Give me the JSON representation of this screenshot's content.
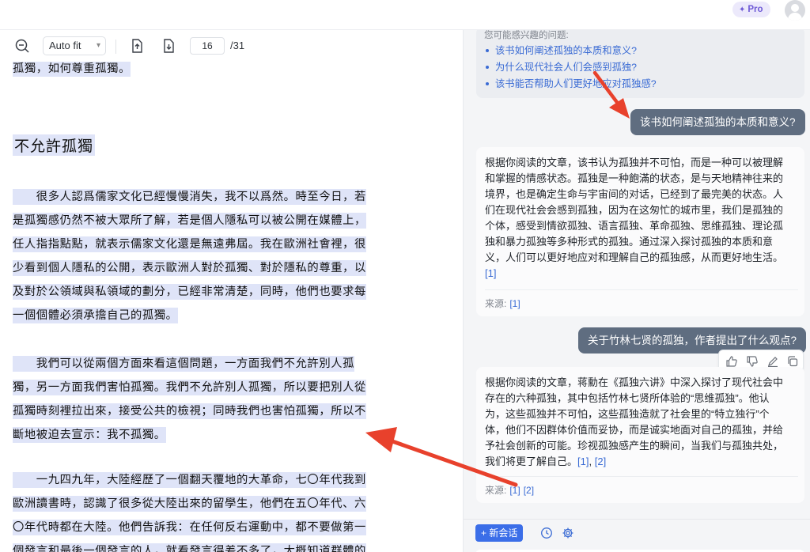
{
  "header": {
    "pro_label": "Pro"
  },
  "pdf_toolbar": {
    "zoom_value": "Auto fit",
    "page_current": "16",
    "page_total": "/31"
  },
  "pdf": {
    "line_top": "孤獨，如何尊重孤獨。",
    "heading": "不允許孤獨",
    "para2": [
      "　　很多人認爲儒家文化已經慢慢消失，我不以爲然。時至今日，若",
      "是孤獨感仍然不被大眾所了解，若是個人隱私可以被公開在媒體上，",
      "任人指指點點，就表示儒家文化還是無遠弗屆。我在歐洲社會裡，很",
      "少看到個人隱私的公開，表示歐洲人對於孤獨、對於隱私的尊重，以",
      "及對於公領域與私領域的劃分，已經非常清楚，同時，他們也要求每",
      "一個個體必須承擔自己的孤獨。"
    ],
    "para3": [
      "　　我們可以從兩個方面來看這個問題，一方面我們不允許別人孤",
      "獨，另一方面我們害怕孤獨。我們不允許別人孤獨，所以要把別人從",
      "孤獨時刻裡拉出來，接受公共的檢視；同時我們也害怕孤獨，所以不",
      "斷地被迫去宣示：我不孤獨。"
    ],
    "para4": [
      "　　一九四九年，大陸經歷了一個翻天覆地的大革命，七〇年代我到",
      "歐洲讀書時，認識了很多從大陸出來的留學生，他們在五〇年代、六",
      "〇年代時都在大陸。他們告訴我：在任何反右運動中，都不要做第一",
      "個發言和最後一個發言的人，就看發言得差不多了，大概知道群體的"
    ]
  },
  "chat": {
    "suggest_title": "您可能感兴趣的问题:",
    "suggestions": [
      "该书如何阐述孤独的本质和意义?",
      "为什么现代社会人们会感到孤独?",
      "该书能否帮助人们更好地应对孤独感?"
    ],
    "q1": "该书如何阐述孤独的本质和意义?",
    "a1_lines": [
      "根据你阅读的文章，该书认为孤独并不可怕，而是一种可以被理解",
      "和掌握的情感状态。孤独是一种飽滿的状态，是与天地精神往来的",
      "境界，也是确定生命与宇宙间的对话，已经到了最完美的状态。人",
      "们在现代社会会感到孤独，因为在这匆忙的城市里，我们是孤独的",
      "个体，感受到情欲孤独、语言孤独、革命孤独、思维孤独、理论孤",
      "独和暴力孤独等多种形式的孤独。通过深入探讨孤独的本质和意",
      "义，人们可以更好地应对和理解自己的孤独感，从而更好地生活。"
    ],
    "a1_ref": "[1]",
    "source_label": "来源:",
    "a1_sources": [
      "[1]"
    ],
    "q2": "关于竹林七贤的孤独，作者提出了什么观点?",
    "a2_lines": [
      "根据你阅读的文章，蒋勳在《孤独六讲》中深入探讨了现代社会中",
      "存在的六种孤独，其中包括竹林七贤所体验的“思维孤独”。他认",
      "为，这些孤独并不可怕，这些孤独造就了社会里的“特立独行”个",
      "体，他们不因群体价值而妥协，而是诚实地面对自己的孤独，并给",
      "予社会创新的可能。珍视孤独感产生的瞬间，当我们与孤独共处，"
    ],
    "a2_last": "我们将更了解自己。",
    "a2_ref1": "[1]",
    "a2_ref_sep": ",",
    "a2_ref2": "[2]",
    "a2_sources": [
      "[1]",
      "[2]"
    ],
    "new_chat_label": "+ 新会话"
  },
  "colors": {
    "accent": "#3b6ee8",
    "user_bubble": "#5f6d80",
    "highlight": "#dfe4f8",
    "arrow": "#e8412c"
  }
}
